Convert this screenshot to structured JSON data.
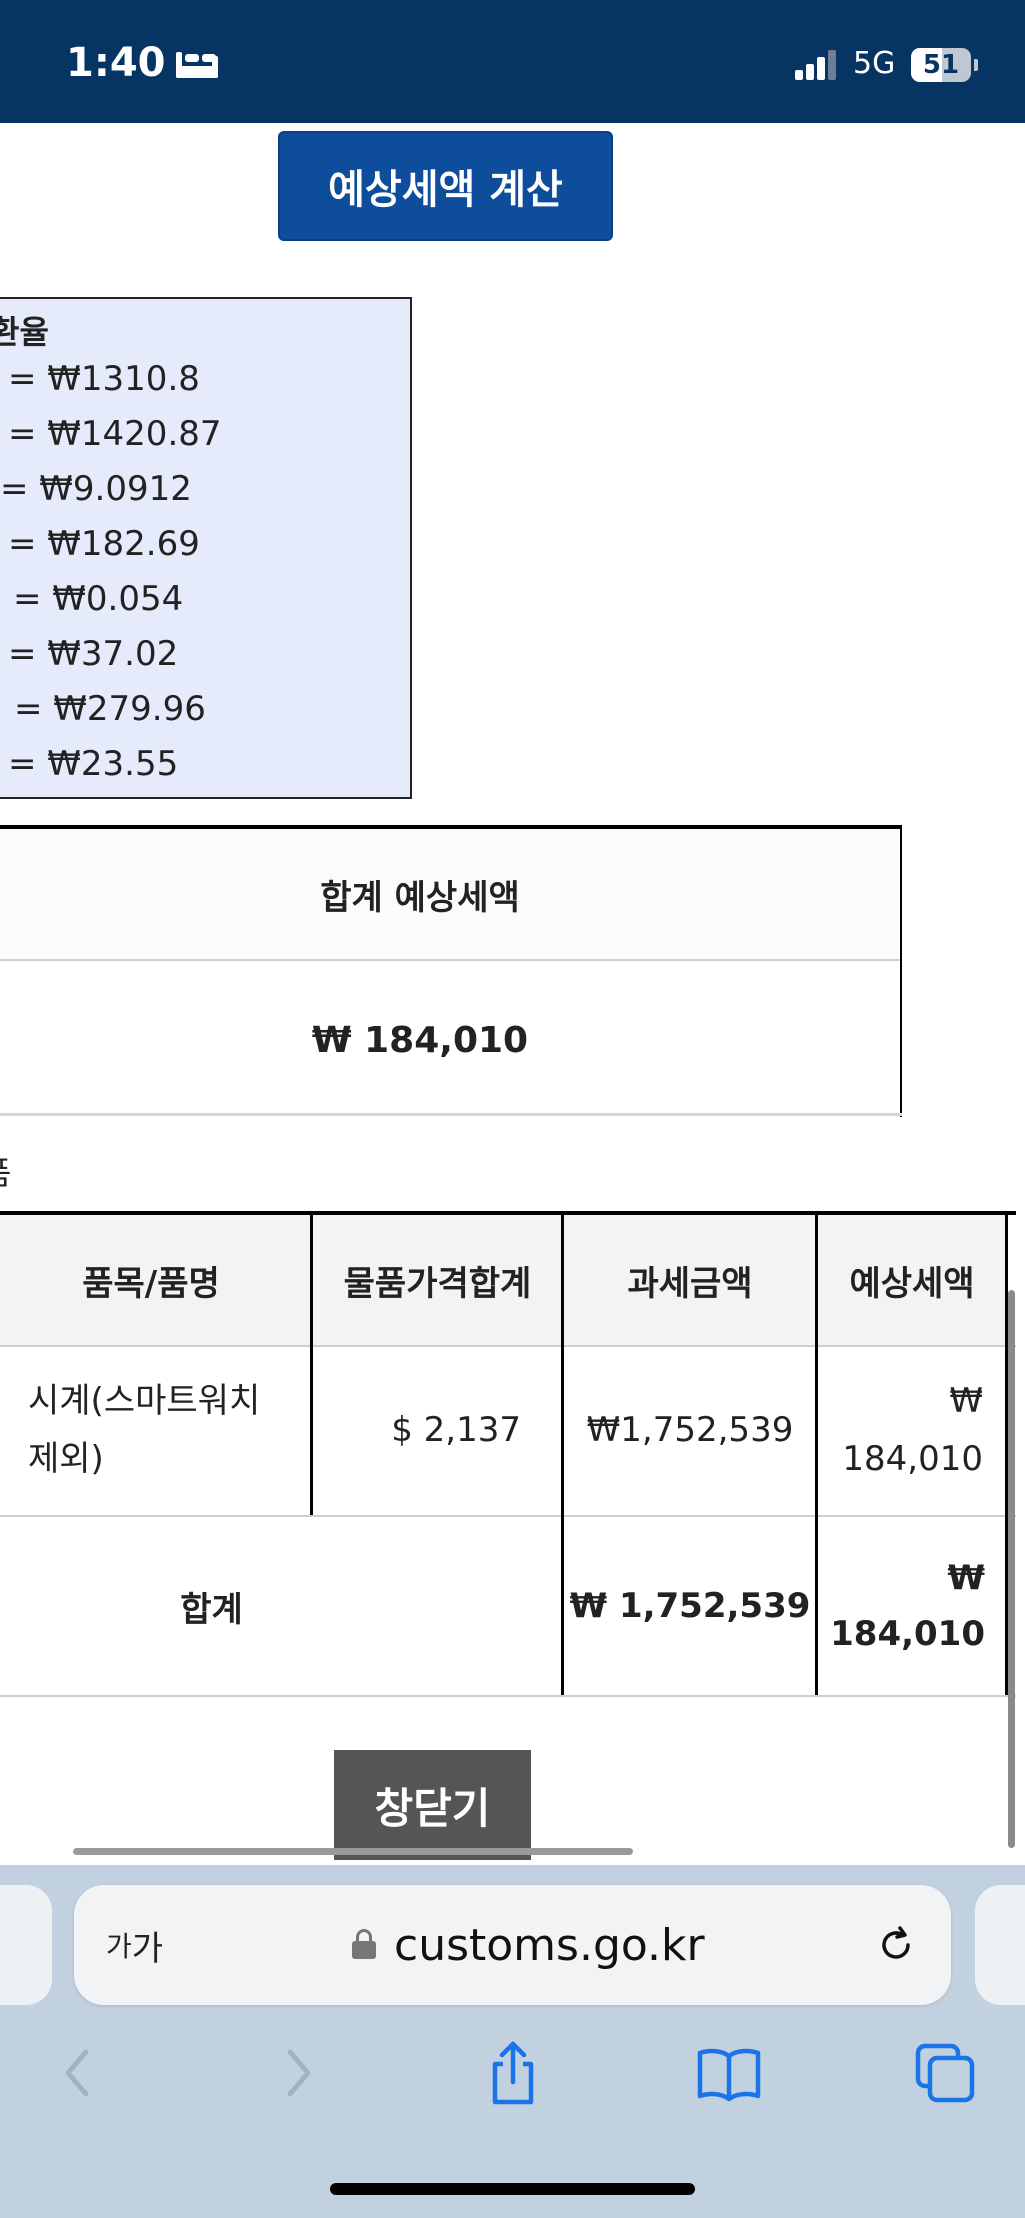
{
  "status_bar": {
    "time": "1:40",
    "network": "5G",
    "battery": "51",
    "battery_level": 0.51
  },
  "calc_button_label": "예상세액 계산",
  "rates": {
    "title": "환율",
    "lines": [
      "= ₩1310.8",
      "= ₩1420.87",
      "= ₩9.0912",
      "= ₩182.69",
      "= ₩0.054",
      "= ₩37.02",
      "= ₩279.96",
      "= ₩23.55"
    ]
  },
  "total_table": {
    "header": "합계 예상세액",
    "value": "₩ 184,010"
  },
  "section_label": "품",
  "detail_table": {
    "headers": [
      "품목/품명",
      "물품가격합계",
      "과세금액",
      "예상세액"
    ],
    "row": {
      "item_line1": "시계(스마트워치",
      "item_line2": "제외)",
      "price": "$ 2,137",
      "taxable": "₩1,752,539",
      "tax_symbol": "₩",
      "tax_amount": "184,010"
    },
    "total": {
      "label": "합계",
      "taxable": "₩ 1,752,539",
      "tax_symbol": "₩",
      "tax_amount": "184,010"
    }
  },
  "close_button_label": "창닫기",
  "browser": {
    "text_size_small": "가",
    "text_size_large": "가",
    "url": "customs.go.kr"
  },
  "colors": {
    "status_bar": "#063563",
    "calc_button": "#0e4c9c",
    "rate_box": "#e5ebfb",
    "close_button": "#555555",
    "toolbar": "#c2d1df",
    "icon_blue": "#1a73e8"
  }
}
